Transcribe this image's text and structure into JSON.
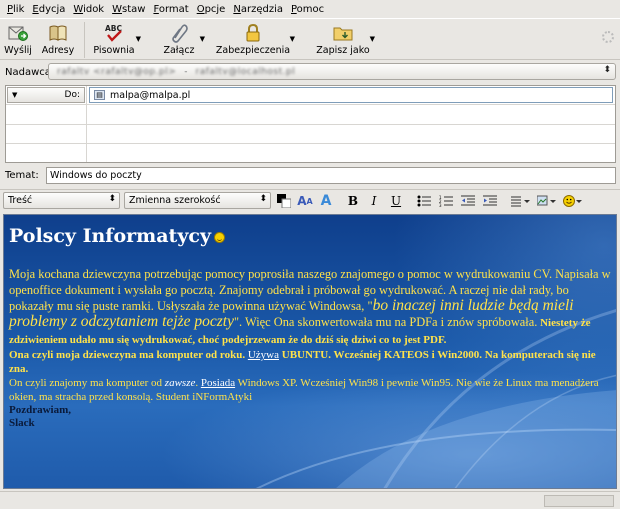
{
  "menu": [
    "Plik",
    "Edycja",
    "Widok",
    "Wstaw",
    "Format",
    "Opcje",
    "Narzędzia",
    "Pomoc"
  ],
  "toolbar": {
    "send": "Wyślij",
    "addresses": "Adresy",
    "spelling": "Pisownia",
    "attach": "Załącz",
    "security": "Zabezpieczenia",
    "save_as": "Zapisz jako"
  },
  "from": {
    "label": "Nadawca:",
    "value": "rafaltv <rafaltv@op.pl>",
    "account": "rafaltv@localhost.pl"
  },
  "recipients": {
    "type": "Do:",
    "address": "malpa@malpa.pl"
  },
  "subject": {
    "label": "Temat:",
    "value": "Windows do poczty"
  },
  "format": {
    "paragraph": "Treść",
    "font": "Zmienna szerokość",
    "bold": "B",
    "italic": "I",
    "underline": "U"
  },
  "message": {
    "heading": "Polscy Informatycy",
    "p1_a": "Moja kochana dziewczyna potrzebując pomocy poprosiła naszego znajomego o pomoc w wydrukowaniu CV. Napisała w openoffice dokument i wysłała go pocztą. Znajomy odebrał i próbował go wydrukować. A raczej nie dał rady, bo pokazały mu się puste ramki. Usłyszała że powinna używać Windowsa, \"",
    "p1_b": "bo inaczej inni ludzie będą mieli problemy z odczytaniem tejże poczty",
    "p1_c": "\". Więc Ona skonwertowała mu na PDFa i znów spróbowała.",
    "p1_d": " Niestety że zdziwieniem udało mu się wydrukować, choć podejrzewam że do dziś się dziwi co to jest PDF.",
    "p2_a": "Ona czyli moja dziewczyna ma komputer od roku. ",
    "p2_b": "Używa",
    "p2_c": " UBUNTU. Wcześniej  KATEOS i Win2000. Na komputerach się nie zna.",
    "p3_a": "On czyli znajomy ma komputer od ",
    "p3_b": "zawsze",
    "p3_c": ". ",
    "p3_d": "Posiada",
    "p3_e": " Windows XP. Wcześniej Win98 i pewnie Win95. Nie wie że Linux ma menadżera okien, ma stracha przed konsolą. Student iNFormAtyki",
    "sig1": "Pozdrawiam,",
    "sig2": "Slack"
  }
}
